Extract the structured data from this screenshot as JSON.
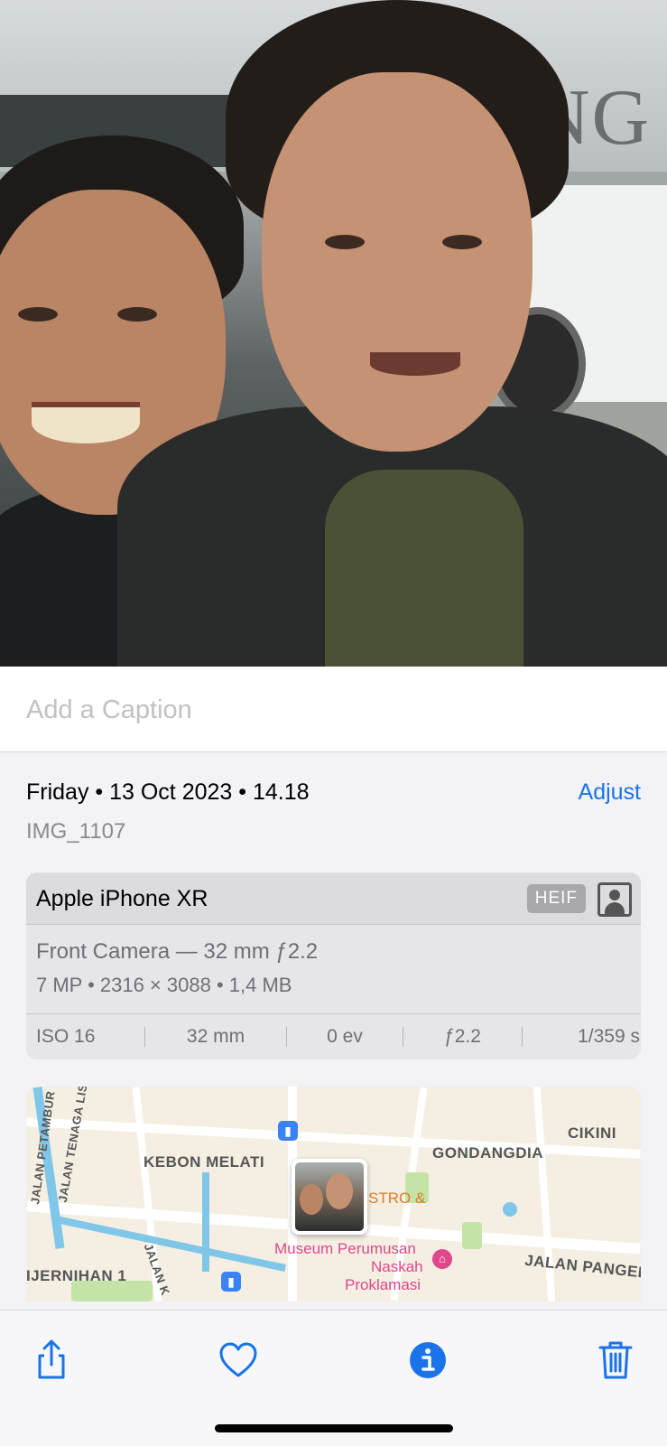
{
  "caption": {
    "placeholder": "Add a Caption"
  },
  "photo_info": {
    "date_line": "Friday • 13 Oct 2023 • 14.18",
    "adjust_label": "Adjust",
    "filename": "IMG_1107"
  },
  "camera": {
    "device": "Apple iPhone XR",
    "format_badge": "HEIF",
    "lens": "Front Camera — 32 mm ƒ2.2",
    "specs": "7 MP  •  2316 × 3088  •  1,4 MB",
    "exif": [
      "ISO 16",
      "32 mm",
      "0 ev",
      "ƒ2.2",
      "1/359 s"
    ]
  },
  "map": {
    "labels": [
      "KEBON MELATI",
      "GONDANGDIA",
      "CIKINI",
      "JALAN PANGER",
      "IJERNIHAN 1",
      "JALAN PETAMBUR",
      "JALAN TENAGA LIS",
      "JALAN K"
    ],
    "poi_museum": "Museum Perumusan",
    "poi_naskah": "Naskah",
    "poi_proklamasi": "Proklamasi",
    "poi_bistro": "STRO &"
  },
  "toolbar": {
    "icons": [
      "share-icon",
      "heart-icon",
      "info-icon",
      "trash-icon"
    ],
    "accent_color": "#1a73e8"
  }
}
